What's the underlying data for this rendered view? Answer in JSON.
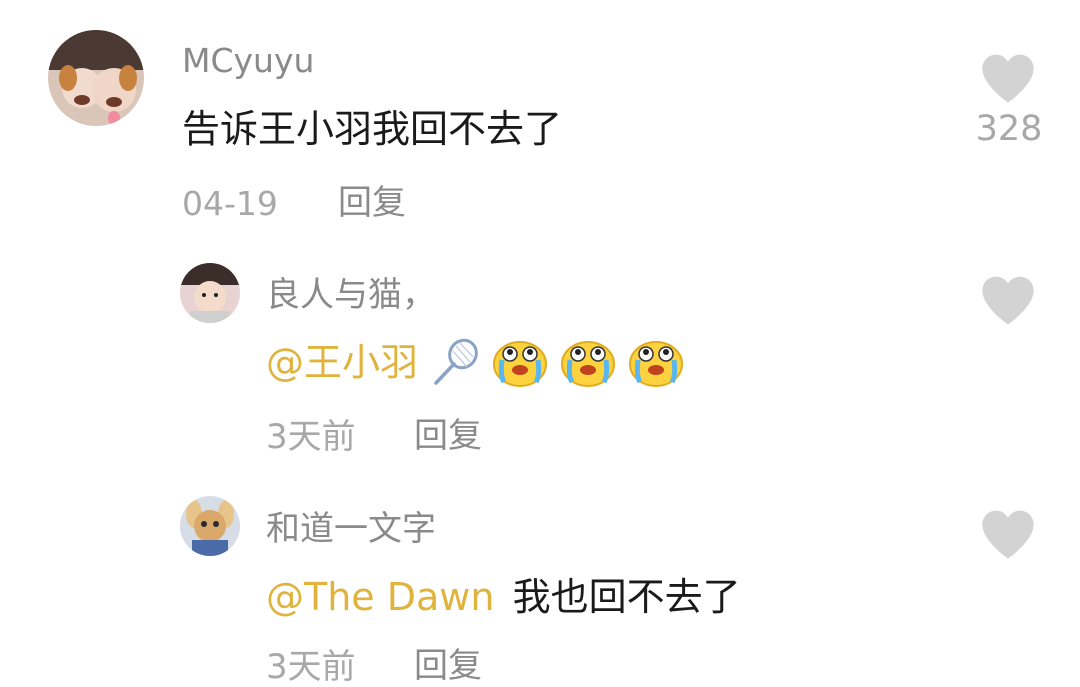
{
  "comments": [
    {
      "username": "MCyuyu",
      "text": "告诉王小羽我回不去了",
      "date": "04-19",
      "reply_label": "回复",
      "like_count": "328"
    }
  ],
  "replies": [
    {
      "username": "良人与猫，",
      "mention": "@王小羽",
      "icons": [
        "badminton-racket-icon",
        "crying-face-emoji",
        "crying-face-emoji",
        "crying-face-emoji"
      ],
      "text": "",
      "date": "3天前",
      "reply_label": "回复"
    },
    {
      "username": "和道一文字",
      "mention": "@The Dawn",
      "text": "我也回不去了",
      "date": "3天前",
      "reply_label": "回复"
    }
  ],
  "colors": {
    "mention": "#e0b43c",
    "username": "#8a8a8a",
    "meta": "#a8a8a8",
    "heart": "#d3d3d3"
  }
}
